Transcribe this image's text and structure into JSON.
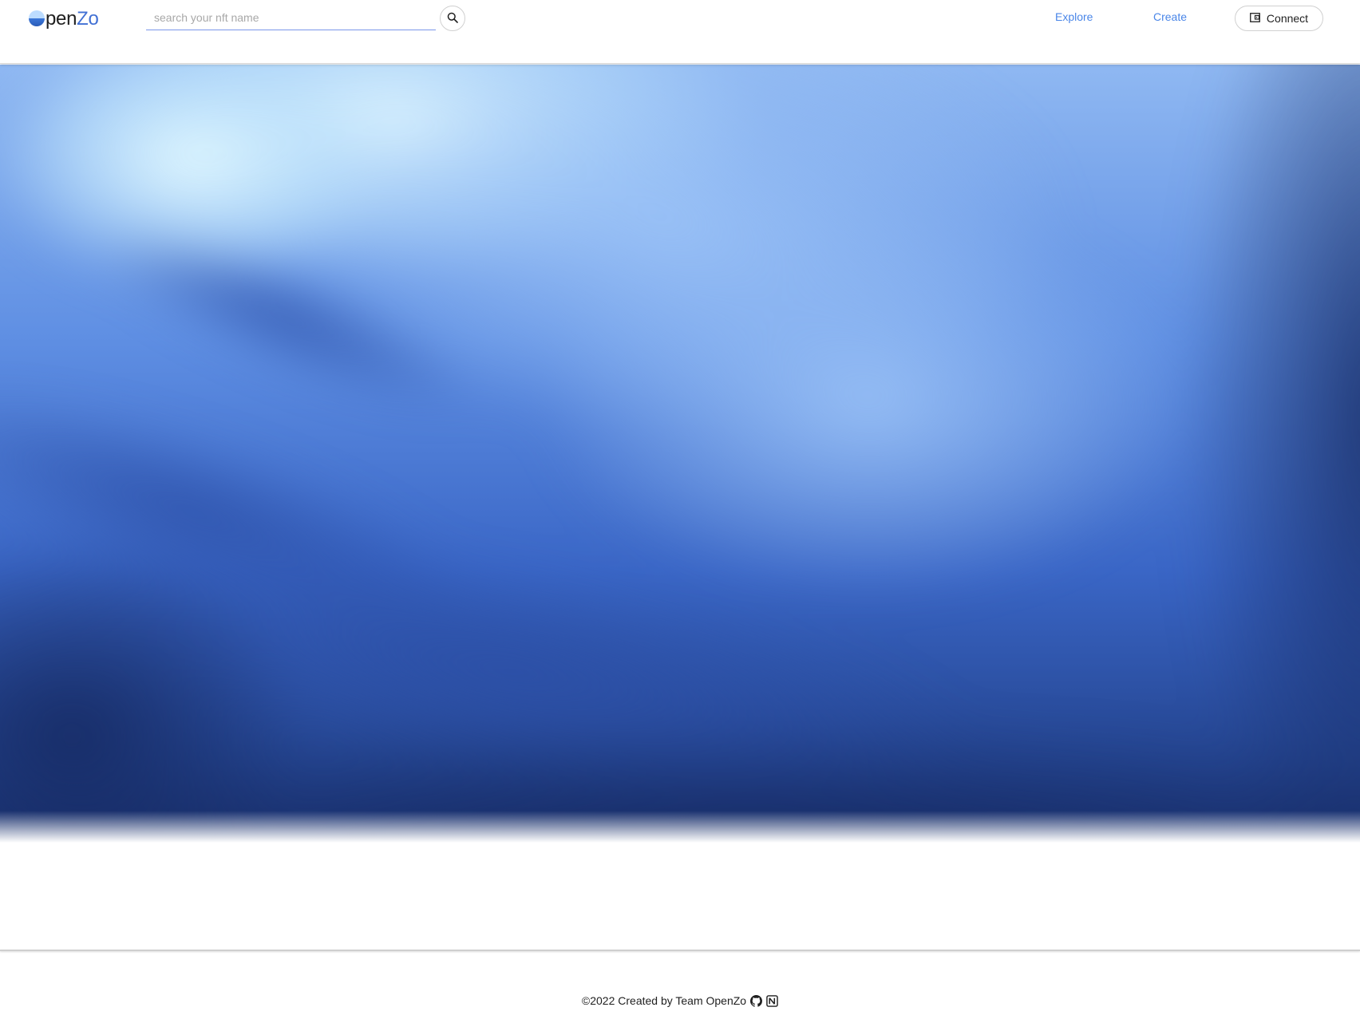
{
  "header": {
    "logo": {
      "prefix_glyph": "O",
      "text_pen": "pen",
      "text_zo": "Zo"
    },
    "search": {
      "placeholder": "search your nft name",
      "value": ""
    },
    "search_button_icon": "search-icon",
    "nav": [
      {
        "label": "Explore"
      },
      {
        "label": "Create"
      }
    ],
    "connect": {
      "label": "Connect",
      "icon": "wallet-icon"
    }
  },
  "hero": {
    "description_icon": "blurred-ocean-background"
  },
  "footer": {
    "text": "©2022 Created by Team OpenZo",
    "icons": [
      "github-icon",
      "notion-icon"
    ]
  },
  "colors": {
    "accent": "#4a86e8",
    "logo_blue": "#4170d4",
    "hero_top": "#8fb8f2",
    "hero_bottom": "#1b3373"
  }
}
